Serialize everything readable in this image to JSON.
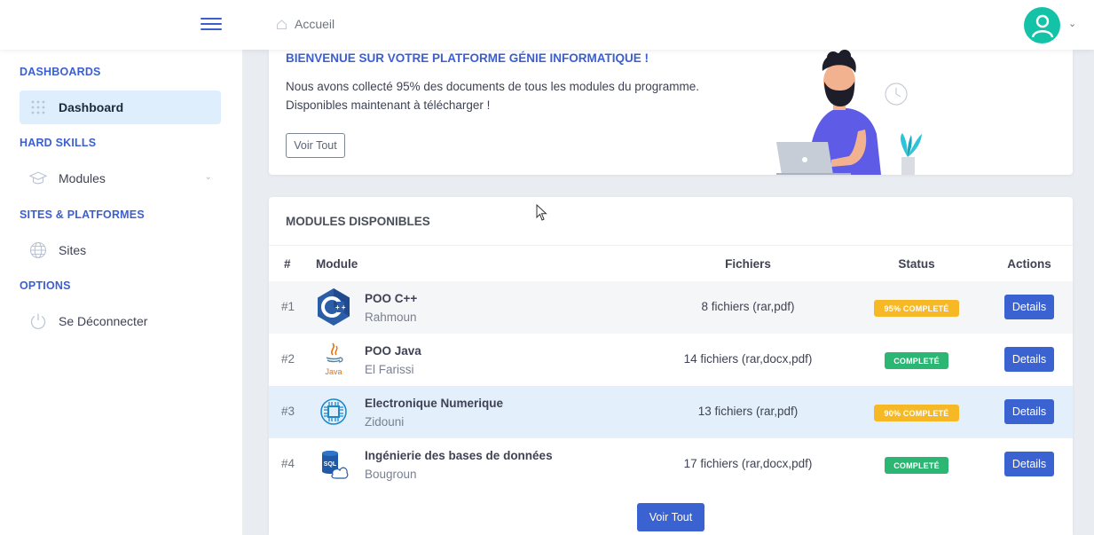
{
  "header": {
    "breadcrumb": "Accueil",
    "icons": {
      "menu": "hamburger-icon",
      "home": "home-icon",
      "avatar": "user-avatar-icon",
      "caret": "chevron-down-icon"
    }
  },
  "sidebar": {
    "sections": [
      {
        "title": "DASHBOARDS",
        "items": [
          {
            "label": "Dashboard",
            "icon": "grid-dots-icon",
            "active": true
          }
        ]
      },
      {
        "title": "HARD SKILLS",
        "items": [
          {
            "label": "Modules",
            "icon": "graduation-cap-icon",
            "expandable": true
          }
        ]
      },
      {
        "title": "SITES & PLATFORMES",
        "items": [
          {
            "label": "Sites",
            "icon": "globe-icon"
          }
        ]
      },
      {
        "title": "OPTIONS",
        "items": [
          {
            "label": "Se Déconnecter",
            "icon": "power-icon"
          }
        ]
      }
    ]
  },
  "welcome": {
    "title": "BIENVENUE SUR VOTRE PLATFORME GÉNIE INFORMATIQUE !",
    "line1": "Nous avons collecté 95% des documents de tous les modules du programme.",
    "line2": "Disponibles maintenant à télécharger !",
    "button": "Voir Tout"
  },
  "modules": {
    "title": "MODULES DISPONIBLES",
    "columns": [
      "#",
      "Module",
      "Fichiers",
      "Status",
      "Actions"
    ],
    "rows": [
      {
        "num": "#1",
        "name": "POO C++",
        "prof": "Rahmoun",
        "files": "8 fichiers (rar,pdf)",
        "status": "95% COMPLETÉ",
        "status_kind": "warning",
        "action": "Details",
        "icon": "cpp-logo-icon"
      },
      {
        "num": "#2",
        "name": "POO Java",
        "prof": "El Farissi",
        "files": "14 fichiers (rar,docx,pdf)",
        "status": "COMPLETÉ",
        "status_kind": "success",
        "action": "Details",
        "icon": "java-logo-icon",
        "icon_text": "Java"
      },
      {
        "num": "#3",
        "name": "Electronique Numerique",
        "prof": "Zidouni",
        "files": "13 fichiers (rar,pdf)",
        "status": "90% COMPLETÉ",
        "status_kind": "warning",
        "action": "Details",
        "icon": "chip-icon"
      },
      {
        "num": "#4",
        "name": "Ingénierie des bases de données",
        "prof": "Bougroun",
        "files": "17 fichiers (rar,docx,pdf)",
        "status": "COMPLETÉ",
        "status_kind": "success",
        "action": "Details",
        "icon": "sql-database-icon",
        "icon_text": "SQL"
      }
    ],
    "footer_button": "Voir Tout"
  },
  "colors": {
    "accent": "#3b5fd1",
    "warning": "#f6b925",
    "success": "#2bb673",
    "avatar": "#14c3a7"
  }
}
